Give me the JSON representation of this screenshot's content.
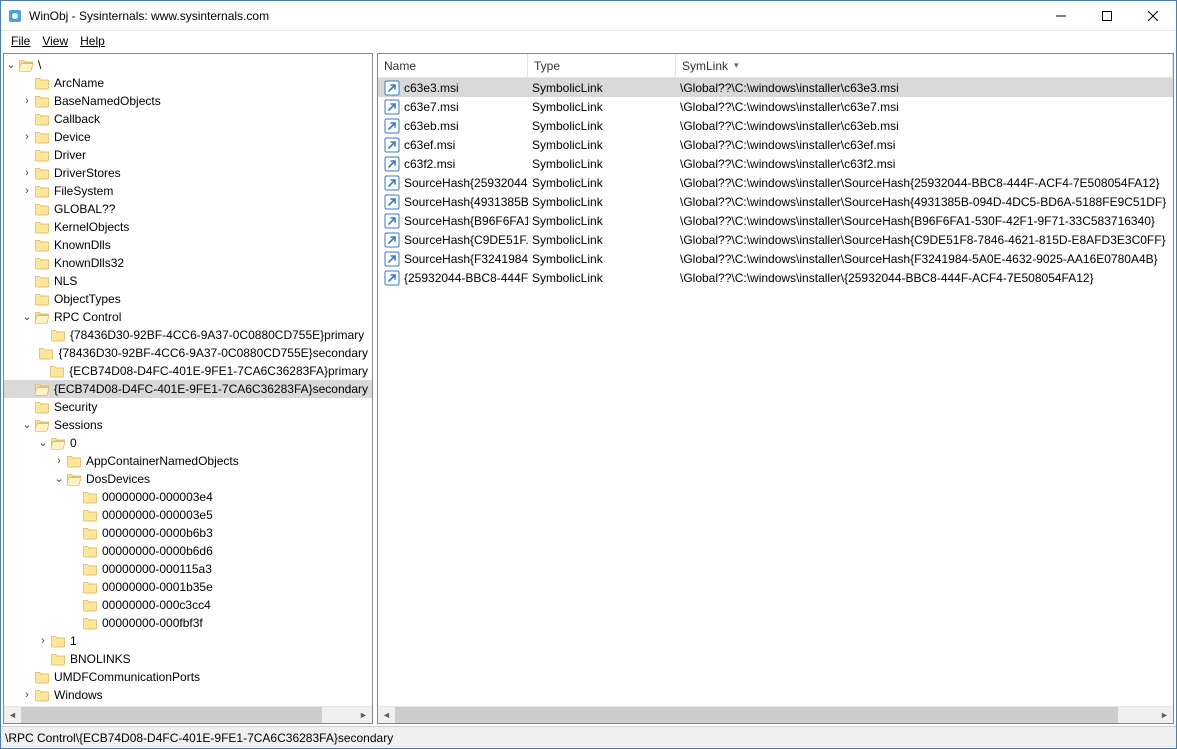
{
  "title": "WinObj - Sysinternals: www.sysinternals.com",
  "menu": {
    "file": "File",
    "view": "View",
    "help": "Help"
  },
  "tree": {
    "root": "\\",
    "arcname": "ArcName",
    "basenamed": "BaseNamedObjects",
    "callback": "Callback",
    "device": "Device",
    "driver": "Driver",
    "driverstores": "DriverStores",
    "filesystem": "FileSystem",
    "globalqq": "GLOBAL??",
    "kernelobjects": "KernelObjects",
    "knowndlls": "KnownDlls",
    "knowndlls32": "KnownDlls32",
    "nls": "NLS",
    "objecttypes": "ObjectTypes",
    "rpc": "RPC Control",
    "rpc_c1": "{78436D30-92BF-4CC6-9A37-0C0880CD755E}primary",
    "rpc_c2": "{78436D30-92BF-4CC6-9A37-0C0880CD755E}secondary",
    "rpc_c3": "{ECB74D08-D4FC-401E-9FE1-7CA6C36283FA}primary",
    "rpc_c4": "{ECB74D08-D4FC-401E-9FE1-7CA6C36283FA}secondary",
    "security": "Security",
    "sessions": "Sessions",
    "s0": "0",
    "appcont": "AppContainerNamedObjects",
    "dosdev": "DosDevices",
    "dd1": "00000000-000003e4",
    "dd2": "00000000-000003e5",
    "dd3": "00000000-0000b6b3",
    "dd4": "00000000-0000b6d6",
    "dd5": "00000000-000115a3",
    "dd6": "00000000-0001b35e",
    "dd7": "00000000-000c3cc4",
    "dd8": "00000000-000fbf3f",
    "s1": "1",
    "bnolinks": "BNOLINKS",
    "umdf": "UMDFCommunicationPorts",
    "windows": "Windows"
  },
  "list": {
    "headers": {
      "name": "Name",
      "type": "Type",
      "symlink": "SymLink"
    },
    "rows": [
      {
        "name": "c63e3.msi",
        "type": "SymbolicLink",
        "sym": "\\Global??\\C:\\windows\\installer\\c63e3.msi"
      },
      {
        "name": "c63e7.msi",
        "type": "SymbolicLink",
        "sym": "\\Global??\\C:\\windows\\installer\\c63e7.msi"
      },
      {
        "name": "c63eb.msi",
        "type": "SymbolicLink",
        "sym": "\\Global??\\C:\\windows\\installer\\c63eb.msi"
      },
      {
        "name": "c63ef.msi",
        "type": "SymbolicLink",
        "sym": "\\Global??\\C:\\windows\\installer\\c63ef.msi"
      },
      {
        "name": "c63f2.msi",
        "type": "SymbolicLink",
        "sym": "\\Global??\\C:\\windows\\installer\\c63f2.msi"
      },
      {
        "name": "SourceHash{25932044...",
        "type": "SymbolicLink",
        "sym": "\\Global??\\C:\\windows\\installer\\SourceHash{25932044-BBC8-444F-ACF4-7E508054FA12}"
      },
      {
        "name": "SourceHash{4931385B...",
        "type": "SymbolicLink",
        "sym": "\\Global??\\C:\\windows\\installer\\SourceHash{4931385B-094D-4DC5-BD6A-5188FE9C51DF}"
      },
      {
        "name": "SourceHash{B96F6FA1...",
        "type": "SymbolicLink",
        "sym": "\\Global??\\C:\\windows\\installer\\SourceHash{B96F6FA1-530F-42F1-9F71-33C583716340}"
      },
      {
        "name": "SourceHash{C9DE51F...",
        "type": "SymbolicLink",
        "sym": "\\Global??\\C:\\windows\\installer\\SourceHash{C9DE51F8-7846-4621-815D-E8AFD3E3C0FF}"
      },
      {
        "name": "SourceHash{F3241984...",
        "type": "SymbolicLink",
        "sym": "\\Global??\\C:\\windows\\installer\\SourceHash{F3241984-5A0E-4632-9025-AA16E0780A4B}"
      },
      {
        "name": "{25932044-BBC8-444F...",
        "type": "SymbolicLink",
        "sym": "\\Global??\\C:\\windows\\installer\\{25932044-BBC8-444F-ACF4-7E508054FA12}"
      }
    ]
  },
  "status": "\\RPC Control\\{ECB74D08-D4FC-401E-9FE1-7CA6C36283FA}secondary"
}
